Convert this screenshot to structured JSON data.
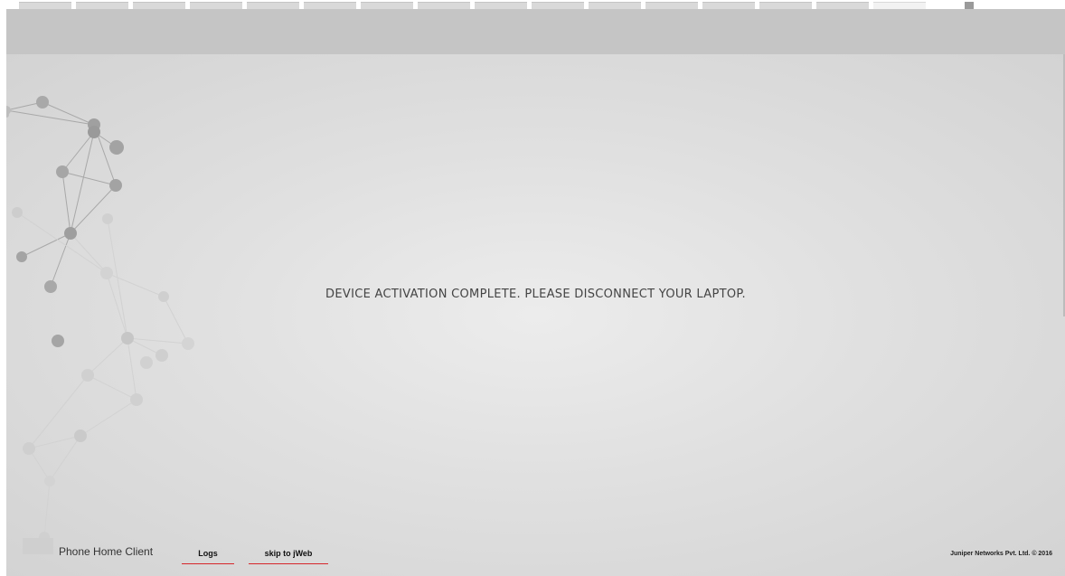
{
  "browser": {
    "tab_count": 16,
    "active_tab_index": 15
  },
  "main": {
    "message": "DEVICE ACTIVATION COMPLETE. PLEASE DISCONNECT YOUR LAPTOP."
  },
  "footer": {
    "app_name": "Phone Home Client",
    "logs_label": "Logs",
    "skip_label": "skip to jWeb",
    "copyright": "Juniper Networks Pvt. Ltd. © 2016"
  },
  "colors": {
    "header_bar": "#c5c5c5",
    "link_underline": "#d6262b",
    "message_text": "#444444"
  }
}
